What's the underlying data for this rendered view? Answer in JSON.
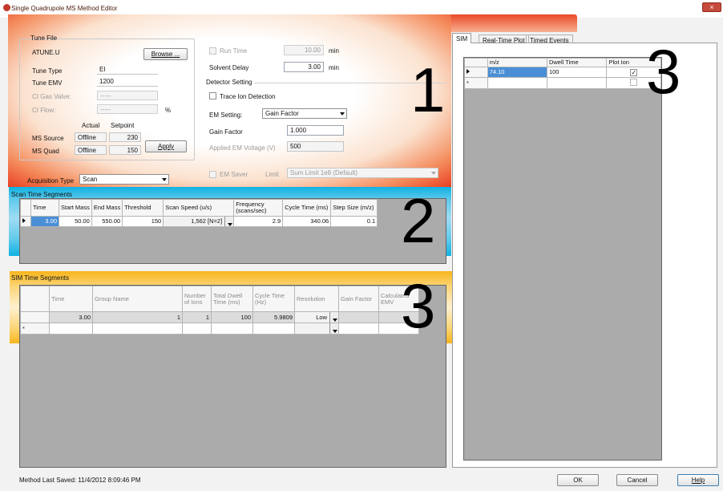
{
  "window": {
    "title": "Single Quadrupole MS Method Editor",
    "close_glyph": "×"
  },
  "annotations": [
    "1",
    "2",
    "3",
    "3"
  ],
  "colors": {
    "highlight_1": "#ea4023",
    "highlight_2": "#0fb2e3",
    "highlight_3": "#f8b51b",
    "selection": "#4a8fd6"
  },
  "tune_file": {
    "group_label": "Tune File",
    "file_name": "ATUNE.U",
    "browse_label": "Browse ...",
    "tune_type_label": "Tune Type",
    "tune_type_value": "EI",
    "tune_emv_label": "Tune EMV",
    "tune_emv_value": "1200",
    "ci_gas_valve_label": "CI Gas Valve:",
    "ci_gas_valve_value": "-----",
    "ci_flow_label": "CI Flow:",
    "ci_flow_value": "-----",
    "ci_flow_unit": "%",
    "actual_header": "Actual",
    "setpoint_header": "Setpoint",
    "ms_source_label": "MS Source",
    "ms_source_actual": "Offline",
    "ms_source_setpoint": "230",
    "ms_quad_label": "MS Quad",
    "ms_quad_actual": "Offline",
    "ms_quad_setpoint": "150",
    "apply_label": "Apply"
  },
  "acquisition": {
    "label": "Acquisition Type",
    "value": "Scan"
  },
  "run": {
    "run_time_label": "Run Time",
    "run_time_value": "10.00",
    "run_time_unit": "min",
    "solvent_delay_label": "Solvent Delay",
    "solvent_delay_value": "3.00",
    "solvent_delay_unit": "min"
  },
  "detector": {
    "group_label": "Detector Setting",
    "trace_ion_label": "Trace Ion Detection",
    "em_setting_label": "EM Setting:",
    "em_setting_value": "Gain Factor",
    "gain_factor_label": "Gain Factor",
    "gain_factor_value": "1.000",
    "applied_em_label": "Applied EM Voltage (V)",
    "applied_em_value": "500",
    "em_saver_label": "EM Saver",
    "limit_label": "Limit",
    "limit_value": "Sum Limit 1e8 (Default)"
  },
  "scan_segments": {
    "title": "Scan Time Segments",
    "headers": [
      "Time",
      "Start Mass",
      "End Mass",
      "Threshold",
      "Scan Speed (u/s)",
      "Frequency (scans/sec)",
      "Cycle Time (ms)",
      "Step Size (m/z)"
    ],
    "row": {
      "time": "3.00",
      "start_mass": "50.00",
      "end_mass": "550.00",
      "threshold": "150",
      "scan_speed": "1,562 [N=2]",
      "frequency": "2.9",
      "cycle_time": "340.06",
      "step_size": "0.1"
    }
  },
  "sim_segments": {
    "title": "SIM Time Segments",
    "headers": [
      "Time",
      "Group Name",
      "Number of Ions",
      "Total Dwell Time (ms)",
      "Cycle Time (Hz)",
      "Resolution",
      "Gain Factor",
      "Calculated EMV"
    ],
    "row": {
      "time": "3.00",
      "group_name": "1",
      "num_ions": "1",
      "total_dwell": "100",
      "cycle_time": "5.9809",
      "resolution": "Low"
    },
    "new_row_marker": "*"
  },
  "right_panel": {
    "tabs": [
      "SIM",
      "Real-Time Plot",
      "Timed Events"
    ],
    "headers": [
      "m/z",
      "Dwell Time",
      "Plot Ion"
    ],
    "row": {
      "mz": "74.10",
      "dwell": "100",
      "plot_ion": true
    },
    "new_row_marker": "*"
  },
  "status": {
    "last_saved": "Method Last Saved: 11/4/2012 8:09:46 PM",
    "ok_label": "OK",
    "cancel_label": "Cancel",
    "help_label": "Help"
  }
}
